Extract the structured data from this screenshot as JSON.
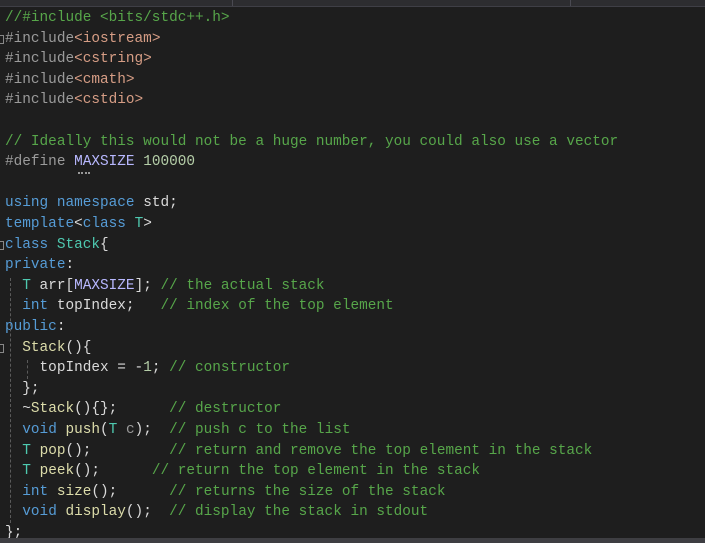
{
  "editor": {
    "language": "C++",
    "lines": [
      {
        "tokens": [
          {
            "t": "//#include <bits/stdc++.h>",
            "c": "comment"
          }
        ]
      },
      {
        "fold": true,
        "tokens": [
          {
            "t": "#include",
            "c": "pre"
          },
          {
            "t": "<iostream>",
            "c": "inc"
          }
        ]
      },
      {
        "tokens": [
          {
            "t": "#include",
            "c": "pre"
          },
          {
            "t": "<cstring>",
            "c": "inc"
          }
        ]
      },
      {
        "tokens": [
          {
            "t": "#include",
            "c": "pre"
          },
          {
            "t": "<cmath>",
            "c": "inc"
          }
        ]
      },
      {
        "tokens": [
          {
            "t": "#include",
            "c": "pre"
          },
          {
            "t": "<cstdio>",
            "c": "inc"
          }
        ]
      },
      {
        "tokens": []
      },
      {
        "tokens": [
          {
            "t": "// Ideally this would not be a huge number, you could also use a vector",
            "c": "comment"
          }
        ]
      },
      {
        "tokens": [
          {
            "t": "#define ",
            "c": "pre"
          },
          {
            "t": "MAXSIZE",
            "c": "macro"
          },
          {
            "t": " ",
            "c": "var"
          },
          {
            "t": "100000",
            "c": "num"
          }
        ]
      },
      {
        "tokens": []
      },
      {
        "tokens": [
          {
            "t": "using namespace ",
            "c": "kw"
          },
          {
            "t": "std",
            "c": "var"
          },
          {
            "t": ";",
            "c": "var"
          }
        ]
      },
      {
        "tokens": [
          {
            "t": "template",
            "c": "kw"
          },
          {
            "t": "<",
            "c": "var"
          },
          {
            "t": "class ",
            "c": "kw"
          },
          {
            "t": "T",
            "c": "type"
          },
          {
            "t": ">",
            "c": "var"
          }
        ]
      },
      {
        "fold": true,
        "tokens": [
          {
            "t": "class ",
            "c": "kw"
          },
          {
            "t": "Stack",
            "c": "type"
          },
          {
            "t": "{",
            "c": "var"
          }
        ]
      },
      {
        "tokens": [
          {
            "t": "private",
            "c": "kw"
          },
          {
            "t": ":",
            "c": "var"
          }
        ]
      },
      {
        "tokens": [
          {
            "t": "  ",
            "c": "var"
          },
          {
            "t": "T",
            "c": "type"
          },
          {
            "t": " arr[",
            "c": "var"
          },
          {
            "t": "MAXSIZE",
            "c": "macro"
          },
          {
            "t": "]; ",
            "c": "var"
          },
          {
            "t": "// the actual stack",
            "c": "comment"
          }
        ]
      },
      {
        "tokens": [
          {
            "t": "  ",
            "c": "var"
          },
          {
            "t": "int",
            "c": "kw"
          },
          {
            "t": " topIndex;   ",
            "c": "var"
          },
          {
            "t": "// index of the top element",
            "c": "comment"
          }
        ]
      },
      {
        "tokens": [
          {
            "t": "public",
            "c": "kw"
          },
          {
            "t": ":",
            "c": "var"
          }
        ]
      },
      {
        "fold": true,
        "tokens": [
          {
            "t": "  ",
            "c": "var"
          },
          {
            "t": "Stack",
            "c": "fn"
          },
          {
            "t": "(){",
            "c": "var"
          }
        ]
      },
      {
        "tokens": [
          {
            "t": "    topIndex = -",
            "c": "var"
          },
          {
            "t": "1",
            "c": "num"
          },
          {
            "t": "; ",
            "c": "var"
          },
          {
            "t": "// constructor",
            "c": "comment"
          }
        ]
      },
      {
        "tokens": [
          {
            "t": "  };",
            "c": "var"
          }
        ]
      },
      {
        "tokens": [
          {
            "t": "  ~",
            "c": "var"
          },
          {
            "t": "Stack",
            "c": "fn"
          },
          {
            "t": "(){};      ",
            "c": "var"
          },
          {
            "t": "// destructor",
            "c": "comment"
          }
        ]
      },
      {
        "tokens": [
          {
            "t": "  ",
            "c": "var"
          },
          {
            "t": "void",
            "c": "kw"
          },
          {
            "t": " ",
            "c": "var"
          },
          {
            "t": "push",
            "c": "fn"
          },
          {
            "t": "(",
            "c": "var"
          },
          {
            "t": "T",
            "c": "type"
          },
          {
            "t": " ",
            "c": "var"
          },
          {
            "t": "c",
            "c": "param"
          },
          {
            "t": ");  ",
            "c": "var"
          },
          {
            "t": "// push c to the list",
            "c": "comment"
          }
        ]
      },
      {
        "tokens": [
          {
            "t": "  ",
            "c": "var"
          },
          {
            "t": "T",
            "c": "type"
          },
          {
            "t": " ",
            "c": "var"
          },
          {
            "t": "pop",
            "c": "fn"
          },
          {
            "t": "();         ",
            "c": "var"
          },
          {
            "t": "// return and remove the top element in the stack",
            "c": "comment"
          }
        ]
      },
      {
        "tokens": [
          {
            "t": "  ",
            "c": "var"
          },
          {
            "t": "T",
            "c": "type"
          },
          {
            "t": " ",
            "c": "var"
          },
          {
            "t": "peek",
            "c": "fn"
          },
          {
            "t": "();      ",
            "c": "var"
          },
          {
            "t": "// return the top element in the stack",
            "c": "comment"
          }
        ]
      },
      {
        "tokens": [
          {
            "t": "  ",
            "c": "var"
          },
          {
            "t": "int",
            "c": "kw"
          },
          {
            "t": " ",
            "c": "var"
          },
          {
            "t": "size",
            "c": "fn"
          },
          {
            "t": "();      ",
            "c": "var"
          },
          {
            "t": "// returns the size of the stack",
            "c": "comment"
          }
        ]
      },
      {
        "tokens": [
          {
            "t": "  ",
            "c": "var"
          },
          {
            "t": "void",
            "c": "kw"
          },
          {
            "t": " ",
            "c": "var"
          },
          {
            "t": "display",
            "c": "fn"
          },
          {
            "t": "();  ",
            "c": "var"
          },
          {
            "t": "// display the stack in stdout",
            "c": "comment"
          }
        ]
      },
      {
        "tokens": [
          {
            "t": "};",
            "c": "var"
          }
        ]
      }
    ]
  }
}
